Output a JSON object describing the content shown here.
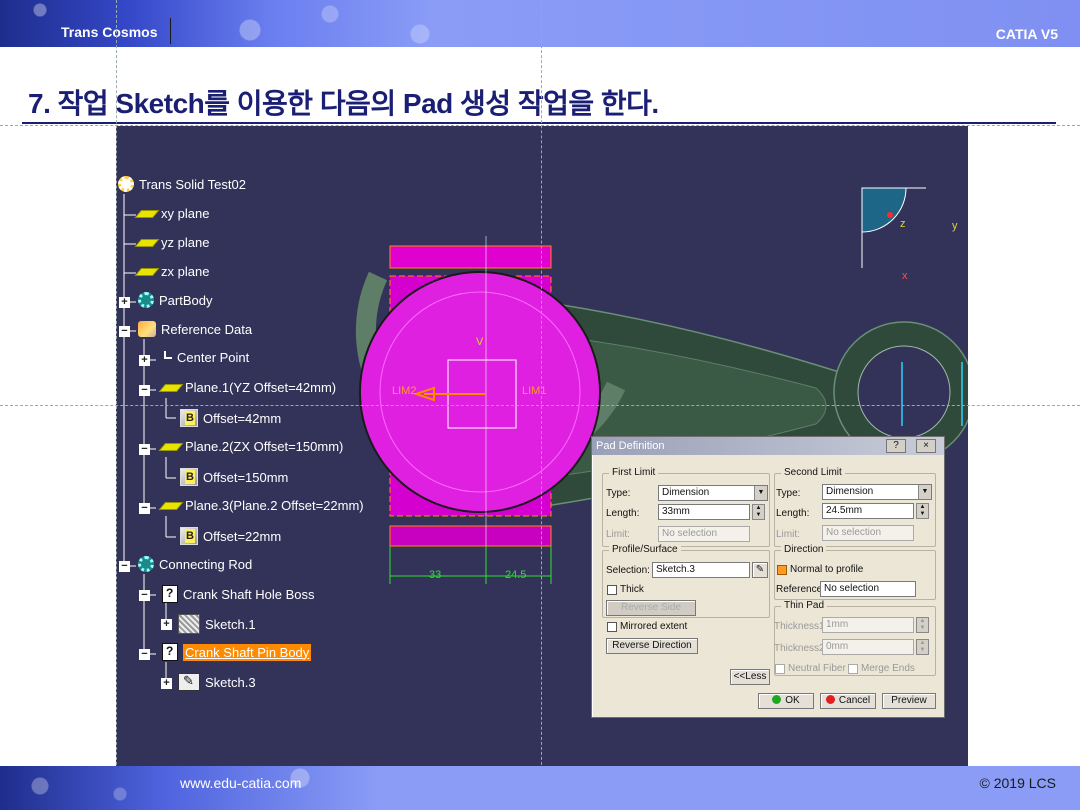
{
  "header": {
    "brand": "Trans Cosmos",
    "product": "CATIA V5"
  },
  "slide": {
    "title": "7. 작업 Sketch를 이용한 다음의 Pad 생성 작업을 한다."
  },
  "footer": {
    "url": "www.edu-catia.com",
    "copyright": "© 2019 LCS"
  },
  "tree": {
    "root": "Trans Solid Test02",
    "items": [
      {
        "label": "xy plane"
      },
      {
        "label": "yz plane"
      },
      {
        "label": "zx plane"
      },
      {
        "label": "PartBody"
      },
      {
        "label": "Reference Data"
      },
      {
        "label": "Center Point"
      },
      {
        "label": "Plane.1(YZ Offset=42mm)"
      },
      {
        "label": "Offset=42mm"
      },
      {
        "label": "Plane.2(ZX Offset=150mm)"
      },
      {
        "label": "Offset=150mm"
      },
      {
        "label": "Plane.3(Plane.2 Offset=22mm)"
      },
      {
        "label": "Offset=22mm"
      },
      {
        "label": "Connecting Rod"
      },
      {
        "label": "Crank Shaft Hole Boss"
      },
      {
        "label": "Sketch.1"
      },
      {
        "label": "Crank Shaft Pin Body"
      },
      {
        "label": "Sketch.3"
      }
    ]
  },
  "viewport": {
    "dims": {
      "left": "33",
      "right": "24.5"
    },
    "labels": {
      "limit1": "LIM1",
      "limit2": "LIM2",
      "v": "V"
    },
    "compass": {
      "z": "z",
      "y": "y",
      "x": "x"
    }
  },
  "dialog": {
    "title": "Pad Definition",
    "help": "?",
    "close": "×",
    "first_limit": {
      "title": "First Limit",
      "type_label": "Type:",
      "type_value": "Dimension",
      "length_label": "Length:",
      "length_value": "33mm",
      "limit_label": "Limit:",
      "limit_value": "No selection"
    },
    "second_limit": {
      "title": "Second Limit",
      "type_label": "Type:",
      "type_value": "Dimension",
      "length_label": "Length:",
      "length_value": "24.5mm",
      "limit_label": "Limit:",
      "limit_value": "No selection"
    },
    "profile": {
      "title": "Profile/Surface",
      "selection_label": "Selection:",
      "selection_value": "Sketch.3",
      "thick_label": "Thick",
      "reverse_side": "Reverse Side"
    },
    "direction": {
      "title": "Direction",
      "normal_label": "Normal to profile",
      "reference_label": "Reference:",
      "reference_value": "No selection"
    },
    "thin_pad": {
      "title": "Thin Pad",
      "thickness1_label": "Thickness1:",
      "thickness1_value": "1mm",
      "thickness2_label": "Thickness2:",
      "thickness2_value": "0mm",
      "neutral_label": "Neutral Fiber",
      "merge_label": "Merge Ends"
    },
    "mirrored_label": "Mirrored extent",
    "reverse_direction": "Reverse Direction",
    "less": "<<Less",
    "ok": "OK",
    "cancel": "Cancel",
    "preview": "Preview",
    "colors": {
      "ok_dot": "#1fa81f",
      "cancel_dot": "#e02020"
    }
  }
}
